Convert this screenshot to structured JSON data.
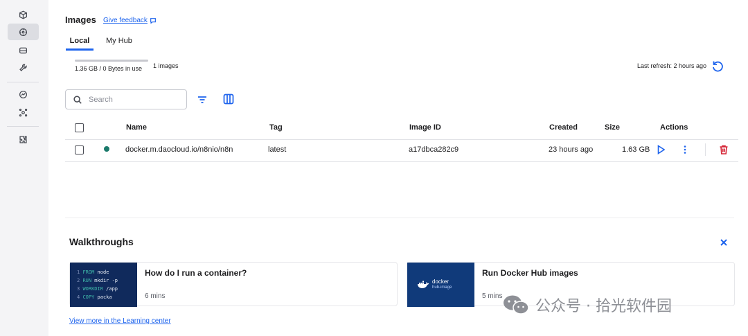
{
  "header": {
    "title": "Images",
    "feedback_label": "Give feedback"
  },
  "tabs": [
    {
      "label": "Local",
      "active": true
    },
    {
      "label": "My Hub",
      "active": false
    }
  ],
  "usage": {
    "text": "1.36 GB / 0 Bytes in use",
    "count": "1 images",
    "fraction": 1.0
  },
  "refresh": {
    "label": "Last refresh: 2 hours ago"
  },
  "search": {
    "placeholder": "Search"
  },
  "table": {
    "columns": [
      "Name",
      "Tag",
      "Image ID",
      "Created",
      "Size",
      "Actions"
    ],
    "rows": [
      {
        "name": "docker.m.daocloud.io/n8nio/n8n",
        "tag": "latest",
        "image_id": "a17dbca282c9",
        "created": "23 hours ago",
        "size": "1.63 GB",
        "status_color": "#1b7a6b"
      }
    ]
  },
  "walkthroughs": {
    "title": "Walkthroughs",
    "cards": [
      {
        "title": "How do I run a container?",
        "duration": "6 mins",
        "code_lines": [
          {
            "num": "1",
            "kw": "FROM",
            "rest": " node"
          },
          {
            "num": "2",
            "kw": "RUN",
            "rest": " mkdir -p"
          },
          {
            "num": "3",
            "kw": "WORKDIR",
            "rest": " /app"
          },
          {
            "num": "4",
            "kw": "COPY",
            "rest": " packa"
          }
        ]
      },
      {
        "title": "Run Docker Hub images",
        "duration": "5 mins",
        "logo_text": "docker",
        "logo_sub": "hub-image"
      }
    ],
    "learn_more": "View more in the Learning center"
  },
  "watermark": {
    "text": "公众号 · 拾光软件园"
  },
  "colors": {
    "accent": "#1d63ed",
    "danger": "#d52536",
    "status_running": "#1b7a6b"
  },
  "icons": {
    "sidebar": [
      "containers-icon",
      "images-icon",
      "volumes-icon",
      "builds-icon",
      "scout-icon",
      "extensions-hub-icon",
      "extensions-icon"
    ],
    "actions": [
      "run-icon",
      "more-vert-icon",
      "delete-icon"
    ]
  }
}
